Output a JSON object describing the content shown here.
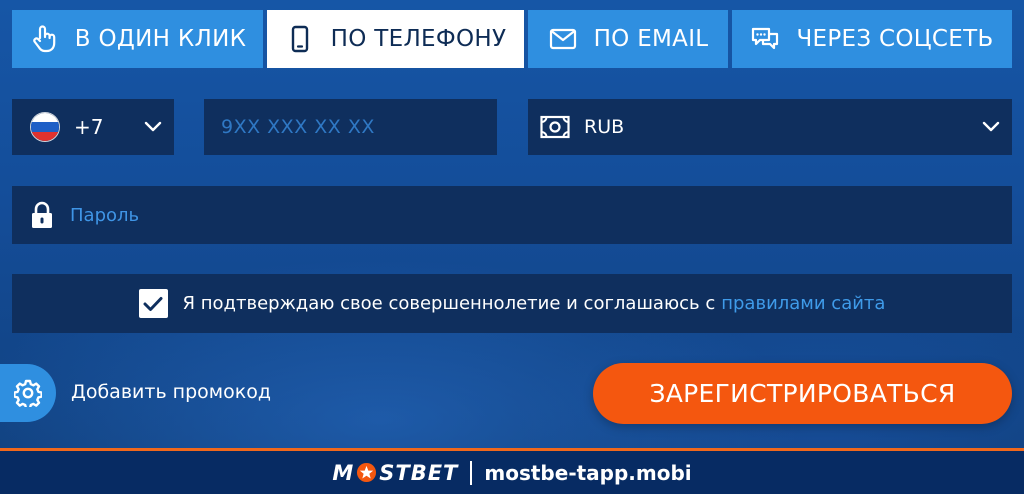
{
  "tabs": [
    {
      "label": "В ОДИН КЛИК",
      "icon": "hand-pointer-icon"
    },
    {
      "label": "ПО ТЕЛЕФОНУ",
      "icon": "smartphone-icon",
      "active": true
    },
    {
      "label": "ПО EMAIL",
      "icon": "envelope-icon"
    },
    {
      "label": "ЧЕРЕЗ СОЦСЕТЬ",
      "icon": "chat-bubbles-icon"
    }
  ],
  "phone": {
    "country_code": "+7",
    "country_flag": "russia-flag",
    "placeholder": "9XX XXX XX XX",
    "value": ""
  },
  "currency": {
    "selected": "RUB",
    "icon": "banknote-icon"
  },
  "password": {
    "placeholder": "Пароль",
    "icon": "lock-icon"
  },
  "agreement": {
    "checked": true,
    "text": "Я подтверждаю свое совершеннолетие и соглашаюсь с",
    "link_text": "правилами сайта"
  },
  "promo": {
    "label": "Добавить промокод",
    "icon": "gear-icon"
  },
  "register_button": "ЗАРЕГИСТРИРОВАТЬСЯ",
  "footer": {
    "logo_left": "M",
    "logo_right": "STBET",
    "site": "mostbe-tapp.mobi"
  },
  "colors": {
    "background": "#13468b",
    "tab": "#2f8fe0",
    "tab_active": "#ffffff",
    "field": "#0f2f5e",
    "accent_orange": "#f4570f",
    "link": "#3f9be9",
    "footer": "#072b63"
  }
}
